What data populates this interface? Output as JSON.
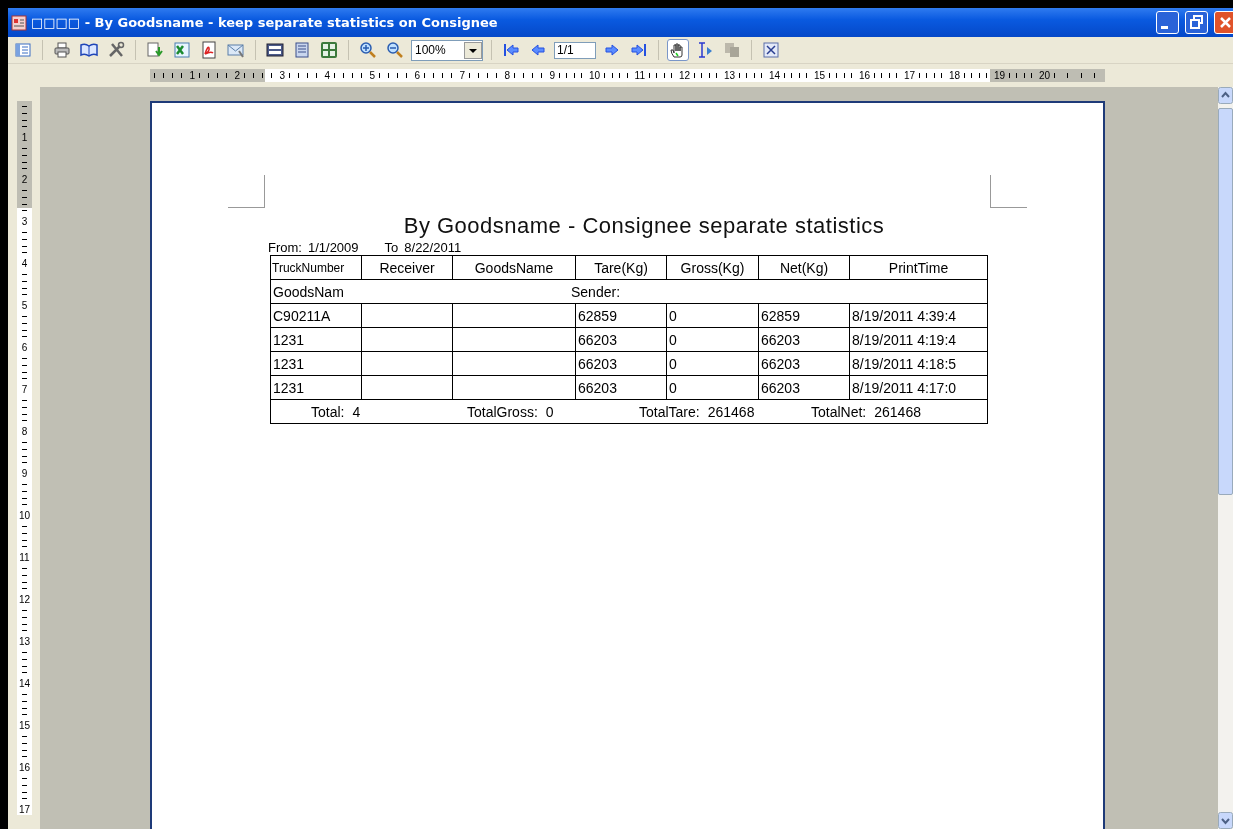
{
  "window": {
    "title": "□□□□ - By Goodsname - keep separate statistics on Consignee"
  },
  "toolbar": {
    "zoom": {
      "value": "100%"
    },
    "page_field": {
      "value": "1/1"
    },
    "hand_tool": {
      "selected": true
    },
    "copy_tool": {
      "disabled": true
    }
  },
  "horizontal_ruler": [
    "1",
    "2",
    "3",
    "4",
    "5",
    "6",
    "7",
    "8",
    "9",
    "10",
    "11",
    "12",
    "13",
    "14",
    "15",
    "16",
    "17",
    "18",
    "19",
    "20"
  ],
  "vertical_ruler": [
    "1",
    "2",
    "3",
    "4",
    "5",
    "6",
    "7",
    "8",
    "9",
    "10",
    "11",
    "12",
    "13",
    "14",
    "15",
    "16",
    "17"
  ],
  "report": {
    "title": "By Goodsname - Consignee separate statistics",
    "date_range": {
      "from_label": "From:",
      "from": "1/1/2009",
      "to_label": "To",
      "to": "8/22/2011"
    },
    "table": {
      "columns": [
        "TruckNumber",
        "Receiver",
        "GoodsName",
        "Tare(Kg)",
        "Gross(Kg)",
        "Net(Kg)",
        "PrintTime"
      ],
      "group": {
        "goods_label": "GoodsNam",
        "sender_label": "Sender:"
      },
      "rows": [
        [
          "C90211A",
          "",
          "",
          "62859",
          "0",
          "62859",
          "8/19/2011 4:39:4"
        ],
        [
          "1231",
          "",
          "",
          "66203",
          "0",
          "66203",
          "8/19/2011 4:19:4"
        ],
        [
          "1231",
          "",
          "",
          "66203",
          "0",
          "66203",
          "8/19/2011 4:18:5"
        ],
        [
          "1231",
          "",
          "",
          "66203",
          "0",
          "66203",
          "8/19/2011 4:17:0"
        ]
      ],
      "totals": [
        {
          "label": "Total:",
          "value": "4"
        },
        {
          "label": "TotalGross:",
          "value": "0"
        },
        {
          "label": "TotalTare:",
          "value": "261468"
        },
        {
          "label": "TotalNet:",
          "value": "261468"
        }
      ]
    }
  }
}
